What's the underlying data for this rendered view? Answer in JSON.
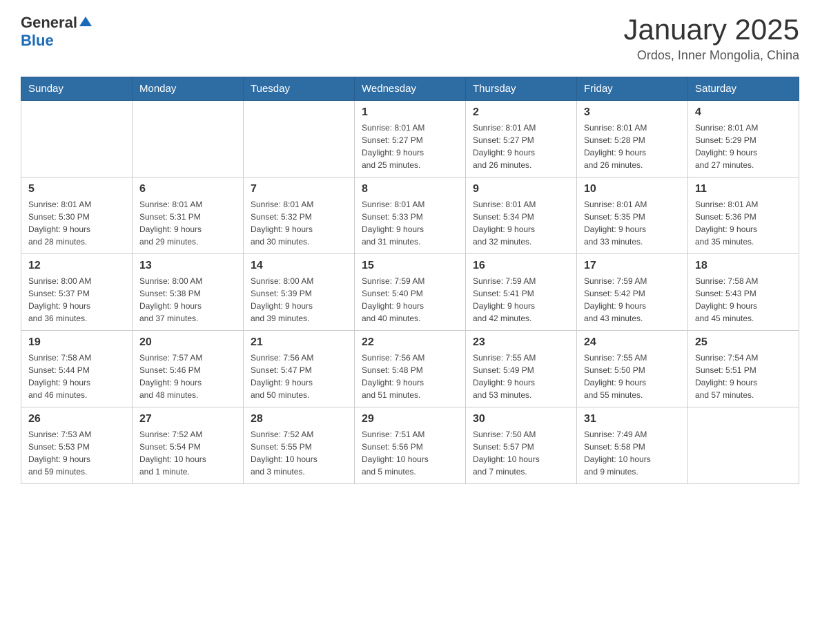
{
  "header": {
    "logo": {
      "general": "General",
      "blue": "Blue"
    },
    "title": "January 2025",
    "subtitle": "Ordos, Inner Mongolia, China"
  },
  "weekdays": [
    "Sunday",
    "Monday",
    "Tuesday",
    "Wednesday",
    "Thursday",
    "Friday",
    "Saturday"
  ],
  "weeks": [
    [
      {
        "day": "",
        "info": ""
      },
      {
        "day": "",
        "info": ""
      },
      {
        "day": "",
        "info": ""
      },
      {
        "day": "1",
        "info": "Sunrise: 8:01 AM\nSunset: 5:27 PM\nDaylight: 9 hours\nand 25 minutes."
      },
      {
        "day": "2",
        "info": "Sunrise: 8:01 AM\nSunset: 5:27 PM\nDaylight: 9 hours\nand 26 minutes."
      },
      {
        "day": "3",
        "info": "Sunrise: 8:01 AM\nSunset: 5:28 PM\nDaylight: 9 hours\nand 26 minutes."
      },
      {
        "day": "4",
        "info": "Sunrise: 8:01 AM\nSunset: 5:29 PM\nDaylight: 9 hours\nand 27 minutes."
      }
    ],
    [
      {
        "day": "5",
        "info": "Sunrise: 8:01 AM\nSunset: 5:30 PM\nDaylight: 9 hours\nand 28 minutes."
      },
      {
        "day": "6",
        "info": "Sunrise: 8:01 AM\nSunset: 5:31 PM\nDaylight: 9 hours\nand 29 minutes."
      },
      {
        "day": "7",
        "info": "Sunrise: 8:01 AM\nSunset: 5:32 PM\nDaylight: 9 hours\nand 30 minutes."
      },
      {
        "day": "8",
        "info": "Sunrise: 8:01 AM\nSunset: 5:33 PM\nDaylight: 9 hours\nand 31 minutes."
      },
      {
        "day": "9",
        "info": "Sunrise: 8:01 AM\nSunset: 5:34 PM\nDaylight: 9 hours\nand 32 minutes."
      },
      {
        "day": "10",
        "info": "Sunrise: 8:01 AM\nSunset: 5:35 PM\nDaylight: 9 hours\nand 33 minutes."
      },
      {
        "day": "11",
        "info": "Sunrise: 8:01 AM\nSunset: 5:36 PM\nDaylight: 9 hours\nand 35 minutes."
      }
    ],
    [
      {
        "day": "12",
        "info": "Sunrise: 8:00 AM\nSunset: 5:37 PM\nDaylight: 9 hours\nand 36 minutes."
      },
      {
        "day": "13",
        "info": "Sunrise: 8:00 AM\nSunset: 5:38 PM\nDaylight: 9 hours\nand 37 minutes."
      },
      {
        "day": "14",
        "info": "Sunrise: 8:00 AM\nSunset: 5:39 PM\nDaylight: 9 hours\nand 39 minutes."
      },
      {
        "day": "15",
        "info": "Sunrise: 7:59 AM\nSunset: 5:40 PM\nDaylight: 9 hours\nand 40 minutes."
      },
      {
        "day": "16",
        "info": "Sunrise: 7:59 AM\nSunset: 5:41 PM\nDaylight: 9 hours\nand 42 minutes."
      },
      {
        "day": "17",
        "info": "Sunrise: 7:59 AM\nSunset: 5:42 PM\nDaylight: 9 hours\nand 43 minutes."
      },
      {
        "day": "18",
        "info": "Sunrise: 7:58 AM\nSunset: 5:43 PM\nDaylight: 9 hours\nand 45 minutes."
      }
    ],
    [
      {
        "day": "19",
        "info": "Sunrise: 7:58 AM\nSunset: 5:44 PM\nDaylight: 9 hours\nand 46 minutes."
      },
      {
        "day": "20",
        "info": "Sunrise: 7:57 AM\nSunset: 5:46 PM\nDaylight: 9 hours\nand 48 minutes."
      },
      {
        "day": "21",
        "info": "Sunrise: 7:56 AM\nSunset: 5:47 PM\nDaylight: 9 hours\nand 50 minutes."
      },
      {
        "day": "22",
        "info": "Sunrise: 7:56 AM\nSunset: 5:48 PM\nDaylight: 9 hours\nand 51 minutes."
      },
      {
        "day": "23",
        "info": "Sunrise: 7:55 AM\nSunset: 5:49 PM\nDaylight: 9 hours\nand 53 minutes."
      },
      {
        "day": "24",
        "info": "Sunrise: 7:55 AM\nSunset: 5:50 PM\nDaylight: 9 hours\nand 55 minutes."
      },
      {
        "day": "25",
        "info": "Sunrise: 7:54 AM\nSunset: 5:51 PM\nDaylight: 9 hours\nand 57 minutes."
      }
    ],
    [
      {
        "day": "26",
        "info": "Sunrise: 7:53 AM\nSunset: 5:53 PM\nDaylight: 9 hours\nand 59 minutes."
      },
      {
        "day": "27",
        "info": "Sunrise: 7:52 AM\nSunset: 5:54 PM\nDaylight: 10 hours\nand 1 minute."
      },
      {
        "day": "28",
        "info": "Sunrise: 7:52 AM\nSunset: 5:55 PM\nDaylight: 10 hours\nand 3 minutes."
      },
      {
        "day": "29",
        "info": "Sunrise: 7:51 AM\nSunset: 5:56 PM\nDaylight: 10 hours\nand 5 minutes."
      },
      {
        "day": "30",
        "info": "Sunrise: 7:50 AM\nSunset: 5:57 PM\nDaylight: 10 hours\nand 7 minutes."
      },
      {
        "day": "31",
        "info": "Sunrise: 7:49 AM\nSunset: 5:58 PM\nDaylight: 10 hours\nand 9 minutes."
      },
      {
        "day": "",
        "info": ""
      }
    ]
  ]
}
